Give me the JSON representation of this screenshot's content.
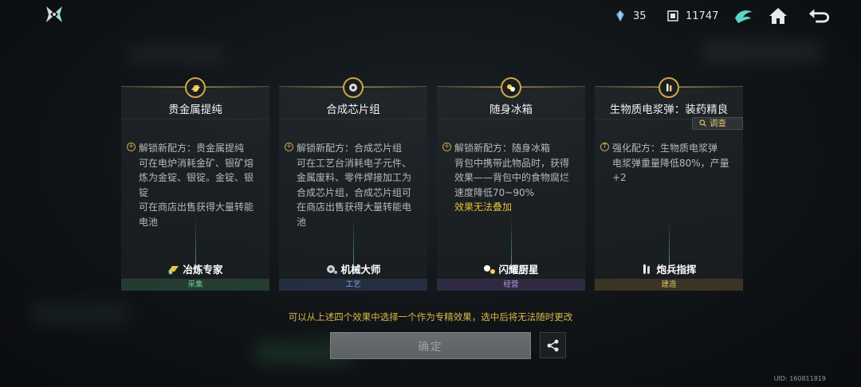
{
  "header": {
    "resource1_value": "35",
    "resource1_icon": "crystal-icon",
    "resource2_value": "11747",
    "resource2_icon": "chip-currency-icon",
    "buttons": [
      "wing-emblem-icon",
      "home-icon",
      "back-icon"
    ]
  },
  "cards": [
    {
      "title": "贵金属提纯",
      "icon": "gold-bars-icon",
      "desc_lines": [
        "解锁新配方：贵金属提纯",
        "可在电炉消耗金矿、银矿熔",
        "炼为金锭、银锭。金锭、银锭",
        "可在商店出售获得大量转能",
        "电池"
      ],
      "profession": "冶炼专家",
      "category": "采集",
      "category_color": "#6fcf8a"
    },
    {
      "title": "合成芯片组",
      "icon": "chip-set-icon",
      "desc_lines": [
        "解锁新配方：合成芯片组",
        "可在工艺台消耗电子元件、",
        "金属废料、零件焊接加工为",
        "合成芯片组，合成芯片组可",
        "在商店出售获得大量转能电",
        "池"
      ],
      "profession": "机械大师",
      "category": "工艺",
      "category_color": "#7ea7e6"
    },
    {
      "title": "随身冰箱",
      "icon": "fridge-icon",
      "desc_lines": [
        "解锁新配方：随身冰箱",
        "背包中携带此物品时，获得",
        "效果——背包中的食物腐烂",
        "速度降低70~90%"
      ],
      "desc_highlight": "效果无法叠加",
      "profession": "闪耀厨星",
      "category": "经营",
      "category_color": "#b89ae6"
    },
    {
      "title": "生物质电浆弹：装药精良",
      "icon": "ammo-icon",
      "desc_lines": [
        "强化配方：生物质电浆弹",
        "电浆弹重量降低80%，产量",
        "+2"
      ],
      "investigate_label": "调查",
      "profession": "炮兵指挥",
      "category": "建造",
      "category_color": "#e0c56a"
    }
  ],
  "footer": {
    "hint": "可以从上述四个效果中选择一个作为专精效果，选中后将无法随时更改",
    "confirm_label": "确定",
    "share_icon": "share-icon",
    "uid": "UID: 160811819"
  }
}
